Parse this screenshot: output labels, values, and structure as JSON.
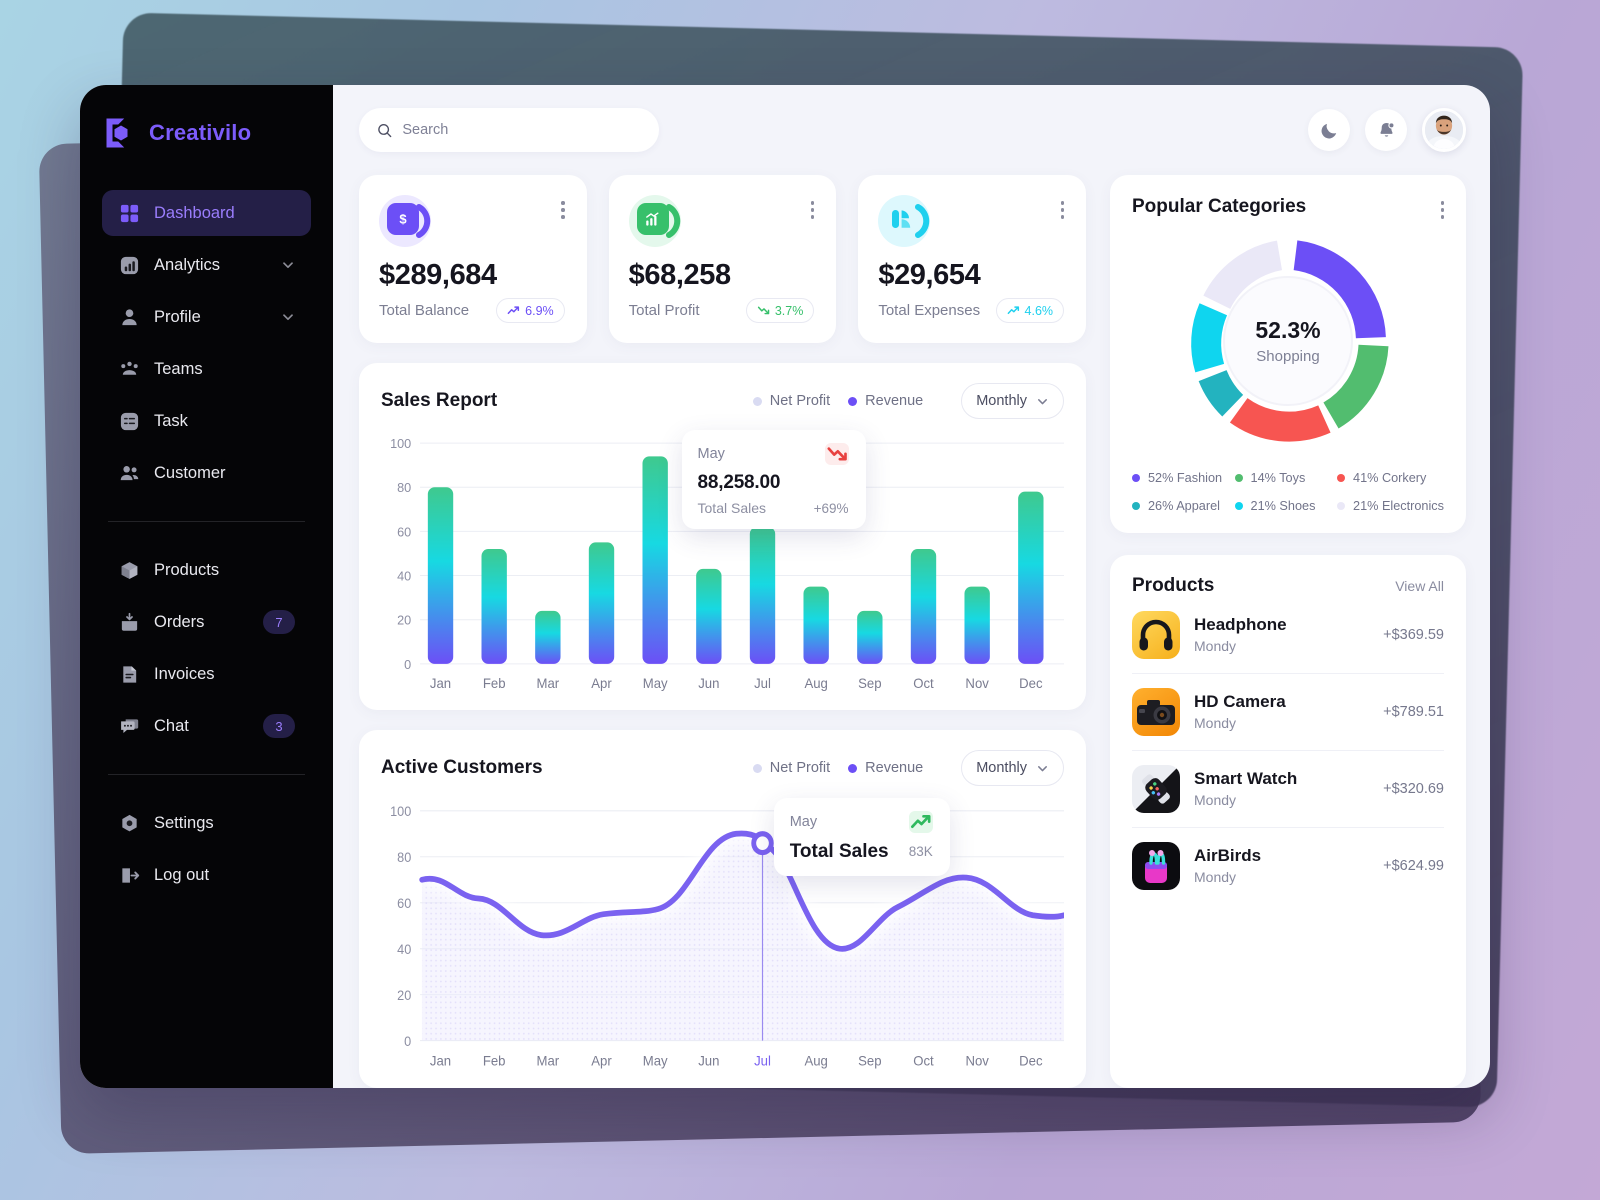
{
  "brand": {
    "name": "Creativilo",
    "logo_icon": "hexagon-bracket-logo",
    "accent": "#7c5cfa"
  },
  "sidebar": {
    "items": [
      {
        "label": "Dashboard",
        "icon": "grid-icon",
        "active": true,
        "badge": null,
        "chevron": false
      },
      {
        "label": "Analytics",
        "icon": "bar-chart-icon",
        "active": false,
        "badge": null,
        "chevron": true
      },
      {
        "label": "Profile",
        "icon": "user-icon",
        "active": false,
        "badge": null,
        "chevron": true
      },
      {
        "label": "Teams",
        "icon": "teams-icon",
        "active": false,
        "badge": null,
        "chevron": false
      },
      {
        "label": "Task",
        "icon": "task-icon",
        "active": false,
        "badge": null,
        "chevron": false
      },
      {
        "label": "Customer",
        "icon": "customers-icon",
        "active": false,
        "badge": null,
        "chevron": false
      }
    ],
    "items2": [
      {
        "label": "Products",
        "icon": "box-icon",
        "badge": null
      },
      {
        "label": "Orders",
        "icon": "orders-icon",
        "badge": "7"
      },
      {
        "label": "Invoices",
        "icon": "invoice-icon",
        "badge": null
      },
      {
        "label": "Chat",
        "icon": "chat-icon",
        "badge": "3"
      }
    ],
    "items3": [
      {
        "label": "Settings",
        "icon": "gear-icon"
      },
      {
        "label": "Log out",
        "icon": "logout-icon"
      }
    ]
  },
  "topbar": {
    "search_placeholder": "Search",
    "search_value": "",
    "search_icon": "search-icon",
    "dark_mode_icon": "moon-icon",
    "notifications_icon": "bell-icon",
    "avatar_label": "user-avatar"
  },
  "stats": [
    {
      "value": "$289,684",
      "label": "Total Balance",
      "delta": "6.9%",
      "direction": "up",
      "color": "#6c4ff6",
      "bg": "#ece8ff",
      "icon": "dollar-icon"
    },
    {
      "value": "$68,258",
      "label": "Total Profit",
      "delta": "3.7%",
      "direction": "down",
      "color": "#37c06b",
      "bg": "#e4f8ec",
      "icon": "growth-chart-icon"
    },
    {
      "value": "$29,654",
      "label": "Total Expenses",
      "delta": "4.6%",
      "direction": "up",
      "color": "#1fd0ee",
      "bg": "#ddf8fd",
      "icon": "bars-icon"
    }
  ],
  "sales_report": {
    "title": "Sales Report",
    "legend": [
      {
        "label": "Net Profit",
        "color": "#d9dbf2"
      },
      {
        "label": "Revenue",
        "color": "#6c4ff6"
      }
    ],
    "period": "Monthly",
    "tooltip": {
      "month": "May",
      "value": "88,258.00",
      "sub": "Total Sales",
      "delta": "+69%",
      "trend": "down"
    }
  },
  "active_customers": {
    "title": "Active Customers",
    "legend": [
      {
        "label": "Net Profit",
        "color": "#d9dbf2"
      },
      {
        "label": "Revenue",
        "color": "#6c4ff6"
      }
    ],
    "period": "Monthly",
    "tooltip": {
      "month": "May",
      "value": "Total Sales",
      "delta": "83K",
      "trend": "up"
    },
    "highlight_month": "Jul"
  },
  "popular_categories": {
    "title": "Popular Categories",
    "center_value": "52.3%",
    "center_label": "Shopping",
    "legend": [
      {
        "label": "52% Fashion",
        "color": "#6c4ff6"
      },
      {
        "label": "14% Toys",
        "color": "#52bd6f"
      },
      {
        "label": "41% Corkery",
        "color": "#f75551"
      },
      {
        "label": "26% Apparel",
        "color": "#23b3bf"
      },
      {
        "label": "21% Shoes",
        "color": "#0fd5ef"
      },
      {
        "label": "21% Electronics",
        "color": "#eae8f7"
      }
    ]
  },
  "products": {
    "title": "Products",
    "view_all": "View All",
    "items": [
      {
        "name": "Headphone",
        "vendor": "Mondy",
        "price": "+$369.59",
        "thumb": "headphone-thumb",
        "thumb_bg": "#f7c333"
      },
      {
        "name": "HD Camera",
        "vendor": "Mondy",
        "price": "+$789.51",
        "thumb": "camera-thumb",
        "thumb_bg": "#f79b13"
      },
      {
        "name": "Smart Watch",
        "vendor": "Mondy",
        "price": "+$320.69",
        "thumb": "smartwatch-thumb",
        "thumb_bg": "#e9ebef"
      },
      {
        "name": "AirBirds",
        "vendor": "Mondy",
        "price": "+$624.99",
        "thumb": "airbuds-thumb",
        "thumb_bg": "#111114"
      }
    ]
  },
  "chart_data": [
    {
      "type": "bar",
      "title": "Sales Report",
      "categories": [
        "Jan",
        "Feb",
        "Mar",
        "Apr",
        "May",
        "Jun",
        "Jul",
        "Aug",
        "Sep",
        "Oct",
        "Nov",
        "Dec"
      ],
      "values": [
        80,
        52,
        24,
        55,
        94,
        43,
        62,
        35,
        24,
        52,
        35,
        78
      ],
      "series": [
        {
          "name": "Revenue",
          "values": [
            80,
            52,
            24,
            55,
            94,
            43,
            62,
            35,
            24,
            52,
            35,
            78
          ]
        }
      ],
      "yticks": [
        0,
        20,
        40,
        60,
        80,
        100
      ],
      "ylim": [
        0,
        100
      ],
      "xlabel": "",
      "ylabel": "",
      "grid": true,
      "legend": [
        "Net Profit",
        "Revenue"
      ],
      "legend_position": "top-right",
      "bar_gradient": [
        "#3fc98e",
        "#18d7e0",
        "#6c4ff6"
      ],
      "annotations": [
        {
          "month": "May",
          "value": "88,258.00",
          "label": "Total Sales",
          "delta": "+69%"
        }
      ]
    },
    {
      "type": "area",
      "title": "Active Customers",
      "categories": [
        "Jan",
        "Feb",
        "Mar",
        "Apr",
        "May",
        "Jun",
        "Jul",
        "Aug",
        "Sep",
        "Oct",
        "Nov",
        "Dec"
      ],
      "values": [
        70,
        62,
        46,
        57,
        59,
        72,
        87,
        62,
        44,
        52,
        65,
        57
      ],
      "series": [
        {
          "name": "Revenue",
          "values": [
            70,
            62,
            46,
            57,
            59,
            72,
            87,
            62,
            44,
            52,
            65,
            57
          ]
        }
      ],
      "yticks": [
        0,
        20,
        40,
        60,
        80,
        100
      ],
      "ylim": [
        0,
        100
      ],
      "xlabel": "",
      "ylabel": "",
      "grid": true,
      "legend": [
        "Net Profit",
        "Revenue"
      ],
      "legend_position": "top-right",
      "line_color": "#7a62f0",
      "marker": {
        "month": "Jul",
        "value": 87
      },
      "annotations": [
        {
          "month": "May",
          "label": "Total Sales",
          "delta": "83K"
        }
      ]
    },
    {
      "type": "pie",
      "title": "Popular Categories",
      "labels": [
        "Fashion",
        "Toys",
        "Corkery",
        "Apparel",
        "Shoes",
        "Electronics"
      ],
      "values": [
        52,
        14,
        41,
        26,
        21,
        21
      ],
      "colors": [
        "#6c4ff6",
        "#52bd6f",
        "#f75551",
        "#23b3bf",
        "#0fd5ef",
        "#eae8f7"
      ],
      "center_value": "52.3%",
      "center_label": "Shopping",
      "donut": true
    }
  ]
}
